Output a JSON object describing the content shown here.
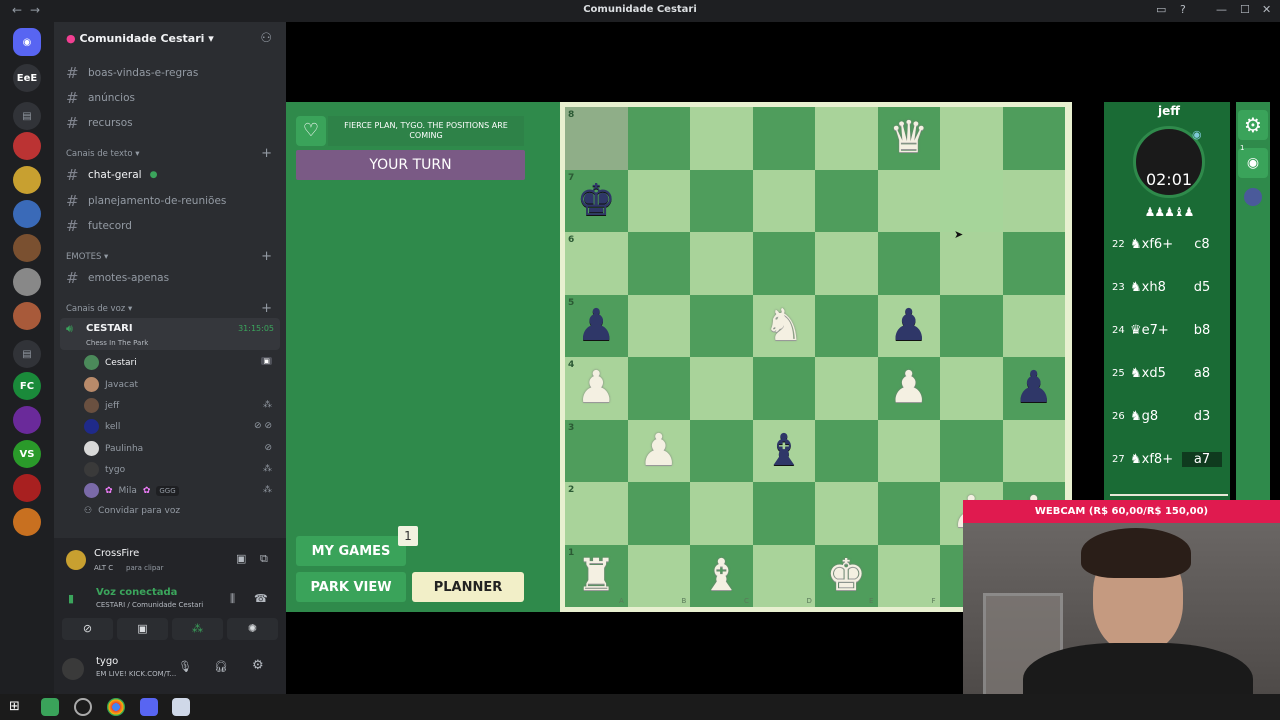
{
  "window": {
    "title": "Comunidade Cestari"
  },
  "discord": {
    "server_name": "Comunidade Cestari",
    "channels_top": [
      {
        "name": "boas-vindas-e-regras"
      },
      {
        "name": "anúncios"
      },
      {
        "name": "recursos"
      }
    ],
    "text_category": "Canais de texto",
    "text_channels": [
      {
        "name": "chat-geral"
      },
      {
        "name": "planejamento-de-reuniões"
      },
      {
        "name": "futecord"
      }
    ],
    "emotes_category": "EMOTES",
    "emotes_channels": [
      {
        "name": "emotes-apenas"
      }
    ],
    "voice_category": "Canais de voz",
    "voice_channel": {
      "name": "CESTARI",
      "time": "31:15:05",
      "status": "Chess In The Park"
    },
    "voice_users": [
      {
        "name": "Cestari",
        "color": "#4b8a5a"
      },
      {
        "name": "Javacat",
        "color": "#b88a6a"
      },
      {
        "name": "jeff",
        "color": "#6a5040"
      },
      {
        "name": "kell",
        "color": "#1f2a8a"
      },
      {
        "name": "Paulinha",
        "color": "#d8d8d8"
      },
      {
        "name": "tygo",
        "color": "#3a3a3a"
      },
      {
        "name": "Mila",
        "tag": "GGG",
        "color": "#7a6aa8"
      }
    ],
    "invite_label": "Convidar para voz",
    "activity": {
      "name": "CrossFire",
      "hint_keys": "ALT C",
      "hint": "para clipar"
    },
    "voice_connected": {
      "label": "Voz conectada",
      "location": "CESTARI / Comunidade Cestari"
    },
    "user": {
      "name": "tygo",
      "status": "EM LIVE! KICK.COM/T..."
    }
  },
  "game": {
    "message": "FIERCE PLAN, TYGO. THE POSITIONS ARE COMING",
    "turn_label": "YOUR TURN",
    "my_games_label": "MY GAMES",
    "my_games_count": "1",
    "park_view_label": "PARK VIEW",
    "planner_label": "PLANNER",
    "opponent": {
      "name": "jeff",
      "clock": "02:01"
    },
    "moves": [
      {
        "num": "22",
        "white": "♞xf6+",
        "black": "c8"
      },
      {
        "num": "23",
        "white": "♞xh8",
        "black": "d5"
      },
      {
        "num": "24",
        "white": "♛e7+",
        "black": "b8"
      },
      {
        "num": "25",
        "white": "♞xd5",
        "black": "a8"
      },
      {
        "num": "26",
        "white": "♞g8",
        "black": "d3"
      },
      {
        "num": "27",
        "white": "♞xf8+",
        "black": "a7"
      }
    ],
    "ranks": [
      "8",
      "7",
      "6",
      "5",
      "4",
      "3",
      "2",
      "1"
    ],
    "files": [
      "A",
      "B",
      "C",
      "D",
      "E",
      "F",
      "G",
      "H"
    ]
  },
  "stream": {
    "webcam_label": "WEBCAM (R$ 60,00/R$ 150,00)"
  },
  "colors": {
    "light_square": "#a9d39a",
    "dark_square": "#4f9d5c",
    "accent_purple": "#6e4f7a",
    "webcam_red": "#e01a4f"
  }
}
